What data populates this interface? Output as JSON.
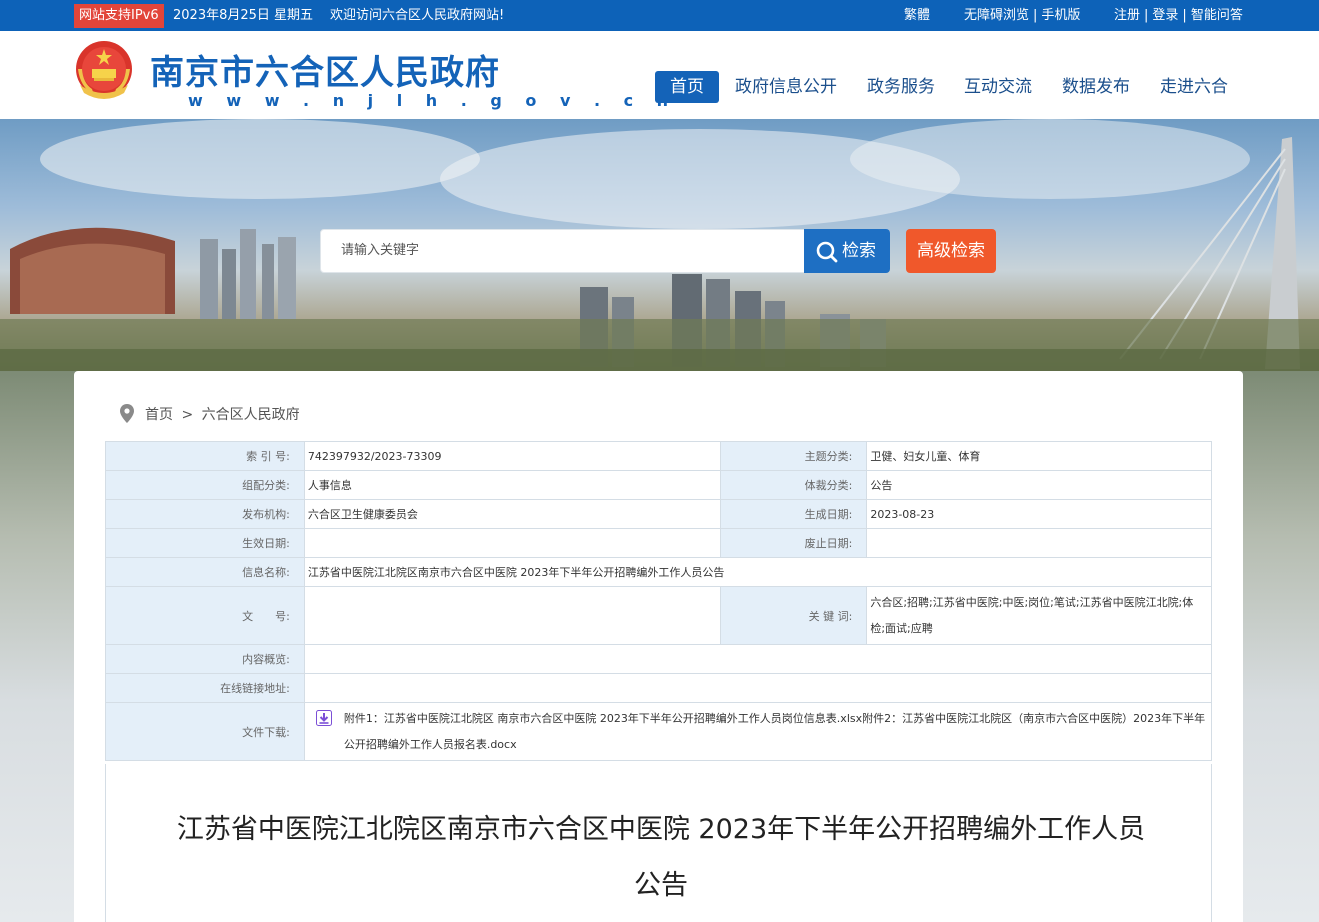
{
  "topbar": {
    "ipv6": "网站支持IPv6",
    "date": "2023年8月25日 星期五",
    "welcome": "欢迎访问六合区人民政府网站!",
    "traditional": "繁體",
    "accessible": "无障碍浏览",
    "mobile": "手机版",
    "register": "注册",
    "login": "登录",
    "qa": "智能问答",
    "sep": "|"
  },
  "header": {
    "title": "南京市六合区人民政府",
    "url": "w w w . n j l h . g o v . c n"
  },
  "nav": [
    "首页",
    "政府信息公开",
    "政务服务",
    "互动交流",
    "数据发布",
    "走进六合"
  ],
  "search": {
    "placeholder": "请输入关键字",
    "button": "检索",
    "advanced": "高级检索"
  },
  "breadcrumb": {
    "home": "首页",
    "sep": ">",
    "current": "六合区人民政府"
  },
  "meta": {
    "index_label": "索 引 号:",
    "index_value": "742397932/2023-73309",
    "topic_label": "主题分类:",
    "topic_value": "卫健、妇女儿童、体育",
    "org_cat_label": "组配分类:",
    "org_cat_value": "人事信息",
    "genre_label": "体裁分类:",
    "genre_value": "公告",
    "publisher_label": "发布机构:",
    "publisher_value": "六合区卫生健康委员会",
    "created_label": "生成日期:",
    "created_value": "2023-08-23",
    "effective_label": "生效日期:",
    "effective_value": "",
    "abolish_label": "废止日期:",
    "abolish_value": "",
    "name_label": "信息名称:",
    "name_value": "江苏省中医院江北院区南京市六合区中医院 2023年下半年公开招聘编外工作人员公告",
    "docno_label": "文　　号:",
    "docno_value": "",
    "keywords_label": "关 键 词:",
    "keywords_value": "六合区;招聘;江苏省中医院;中医;岗位;笔试;江苏省中医院江北院;体检;面试;应聘",
    "summary_label": "内容概览:",
    "summary_value": "",
    "link_label": "在线链接地址:",
    "link_value": "",
    "download_label": "文件下载:",
    "download_value": "附件1：江苏省中医院江北院区 南京市六合区中医院 2023年下半年公开招聘编外工作人员岗位信息表.xlsx附件2：江苏省中医院江北院区（南京市六合区中医院）2023年下半年公开招聘编外工作人员报名表.docx"
  },
  "article": {
    "title_line1": "江苏省中医院江北院区南京市六合区中医院 2023年下半年公开招聘编外工作人员",
    "title_line2": "公告"
  }
}
